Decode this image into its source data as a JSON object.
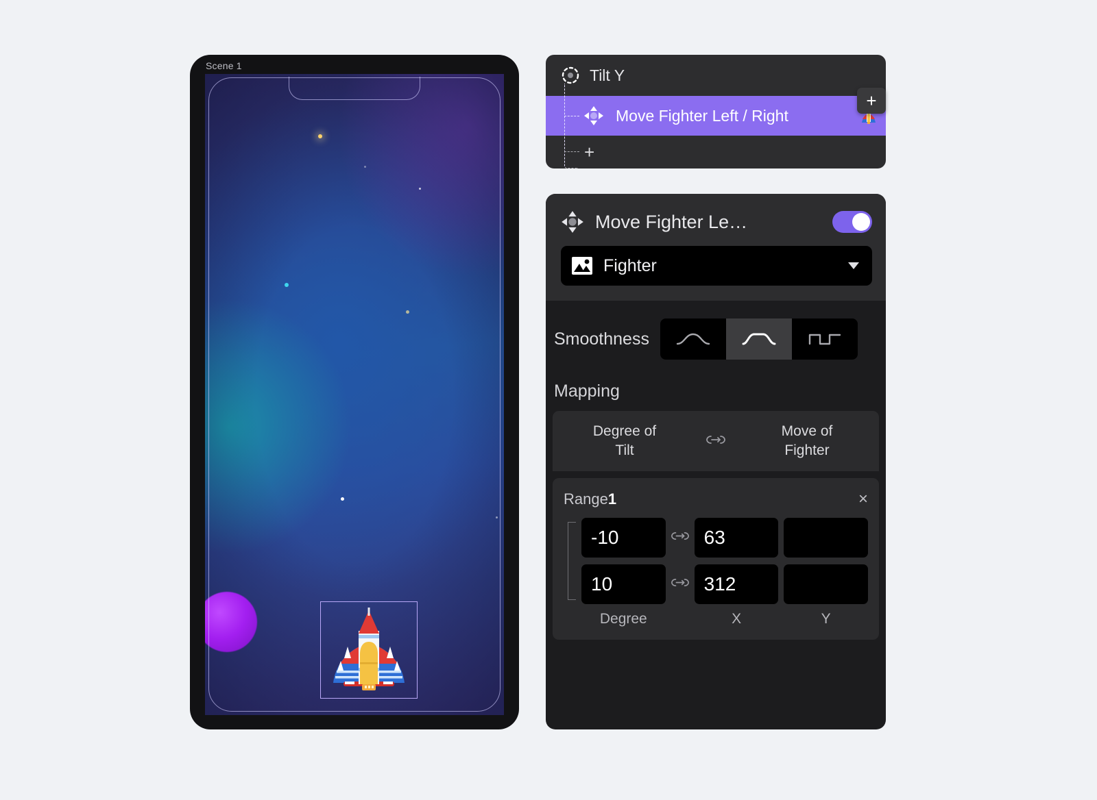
{
  "preview": {
    "scene_label": "Scene 1",
    "sprite_name": "Fighter",
    "sprite_icon": "rocket-sprite"
  },
  "tree_panel": {
    "sensor_icon": "tilt-sensor-icon",
    "title": "Tilt Y",
    "node": {
      "move_icon": "move-arrows-icon",
      "label": "Move Fighter Left / Right",
      "thumb_icon": "rocket-thumbnail",
      "selected": true
    },
    "add_label": "+",
    "float_add_label": "+"
  },
  "detail_panel": {
    "header": {
      "move_icon": "move-arrows-icon",
      "title": "Move Fighter Le…",
      "toggle_on": true
    },
    "target_select": {
      "image_icon": "image-icon",
      "value": "Fighter",
      "caret_icon": "chevron-down-icon"
    },
    "smoothness": {
      "label": "Smoothness",
      "options": [
        {
          "name": "smooth-curve",
          "selected": false
        },
        {
          "name": "medium-curve",
          "selected": true
        },
        {
          "name": "step-curve",
          "selected": false
        }
      ]
    },
    "mapping": {
      "label": "Mapping",
      "source_label": "Degree of\nTilt",
      "source_line1": "Degree of",
      "source_line2": "Tilt",
      "link_icon": "link-arrow-icon",
      "target_line1": "Move of",
      "target_line2": "Fighter"
    },
    "range": {
      "title_text": "Range",
      "title_index": "1",
      "close_icon": "×",
      "link_icon": "link-arrow-icon",
      "rows": [
        {
          "degree": "-10",
          "x": "63",
          "y": ""
        },
        {
          "degree": "10",
          "x": "312",
          "y": ""
        }
      ],
      "col_labels": {
        "degree": "Degree",
        "x": "X",
        "y": "Y"
      }
    }
  },
  "colors": {
    "accent": "#8b6df0",
    "toggle_on": "#7d63ec",
    "panel_bg": "#2d2d2f",
    "detail_bg": "#1c1c1e",
    "field_bg": "#000000",
    "page_bg": "#f0f2f5",
    "planet": "#a31ff0",
    "selection_outline": "#b9a8f7"
  }
}
